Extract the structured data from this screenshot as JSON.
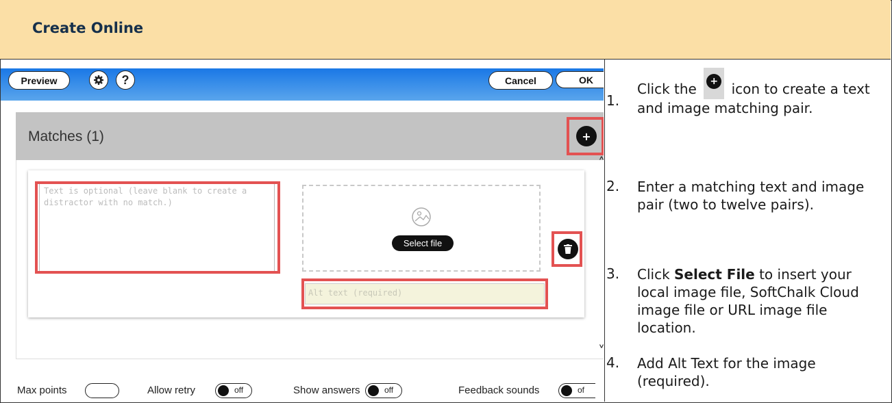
{
  "header": {
    "title": "Create Online"
  },
  "toolbar": {
    "preview_label": "Preview",
    "settings_icon": "gear-icon",
    "help_label": "?",
    "cancel_label": "Cancel",
    "ok_label": "OK",
    "gradient_colors": [
      "#1a78e6",
      "#5aa5ec"
    ]
  },
  "matches": {
    "title": "Matches (1)",
    "add_icon": "plus-icon",
    "text_placeholder": "Text is optional (leave blank to create a distractor with no match.)",
    "select_file_label": "Select file",
    "alt_placeholder": "Alt text (required)",
    "delete_icon": "trash-icon"
  },
  "settings": {
    "max_points_label": "Max points",
    "allow_retry_label": "Allow retry",
    "allow_retry_state": "off",
    "show_answers_label": "Show answers",
    "show_answers_state": "off",
    "feedback_sounds_label": "Feedback sounds",
    "feedback_sounds_state": "of"
  },
  "instructions": {
    "step1_num": "1.",
    "step1_before": "Click the",
    "step1_after": "icon to create a text and image matching pair.",
    "step2_num": "2.",
    "step2": "Enter a matching text and image pair (two to twelve pairs).",
    "step3_num": "3.",
    "step3_before": "Click",
    "step3_bold": "Select File",
    "step3_after": "to insert your local image file, SoftChalk Cloud image file or URL image file location.",
    "step4_num": "4.",
    "step4": "Add Alt Text for the image (required)."
  },
  "colors": {
    "header_bg": "#fbdfa6",
    "highlight_red": "#e35252",
    "matches_bar": "#c3c3c3"
  }
}
